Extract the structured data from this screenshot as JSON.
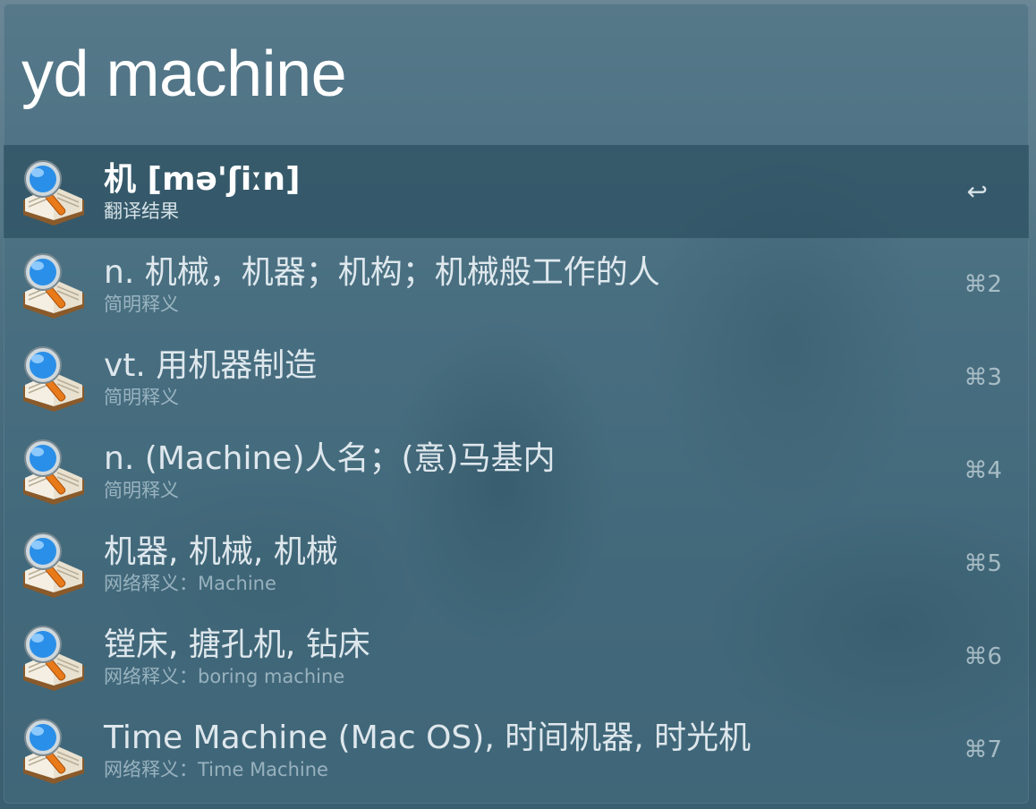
{
  "query": "yd machine",
  "results": [
    {
      "title": "机 [mə'ʃiːn]",
      "subtitle": "翻译结果",
      "shortcut": "↩",
      "selected": true,
      "icon": "dictionary-magnifier-icon"
    },
    {
      "title": "n. 机械，机器；机构；机械般工作的人",
      "subtitle": "简明释义",
      "shortcut": "⌘2",
      "icon": "dictionary-magnifier-icon"
    },
    {
      "title": "vt. 用机器制造",
      "subtitle": "简明释义",
      "shortcut": "⌘3",
      "icon": "dictionary-magnifier-icon"
    },
    {
      "title": "n. (Machine)人名；(意)马基内",
      "subtitle": "简明释义",
      "shortcut": "⌘4",
      "icon": "dictionary-magnifier-icon"
    },
    {
      "title": "机器, 机械, 机械",
      "subtitle": "网络释义：Machine",
      "shortcut": "⌘5",
      "icon": "dictionary-magnifier-icon"
    },
    {
      "title": "镗床, 搪孔机, 钻床",
      "subtitle": "网络释义：boring machine",
      "shortcut": "⌘6",
      "icon": "dictionary-magnifier-icon"
    },
    {
      "title": "Time Machine (Mac OS), 时间机器, 时光机",
      "subtitle": "网络释义：Time Machine",
      "shortcut": "⌘7",
      "icon": "dictionary-magnifier-icon"
    }
  ],
  "colors": {
    "selected_row": "#2e5666",
    "text": "#ffffff",
    "magnifier_lens": "#2a8fe8",
    "magnifier_handle": "#e87a1a"
  }
}
